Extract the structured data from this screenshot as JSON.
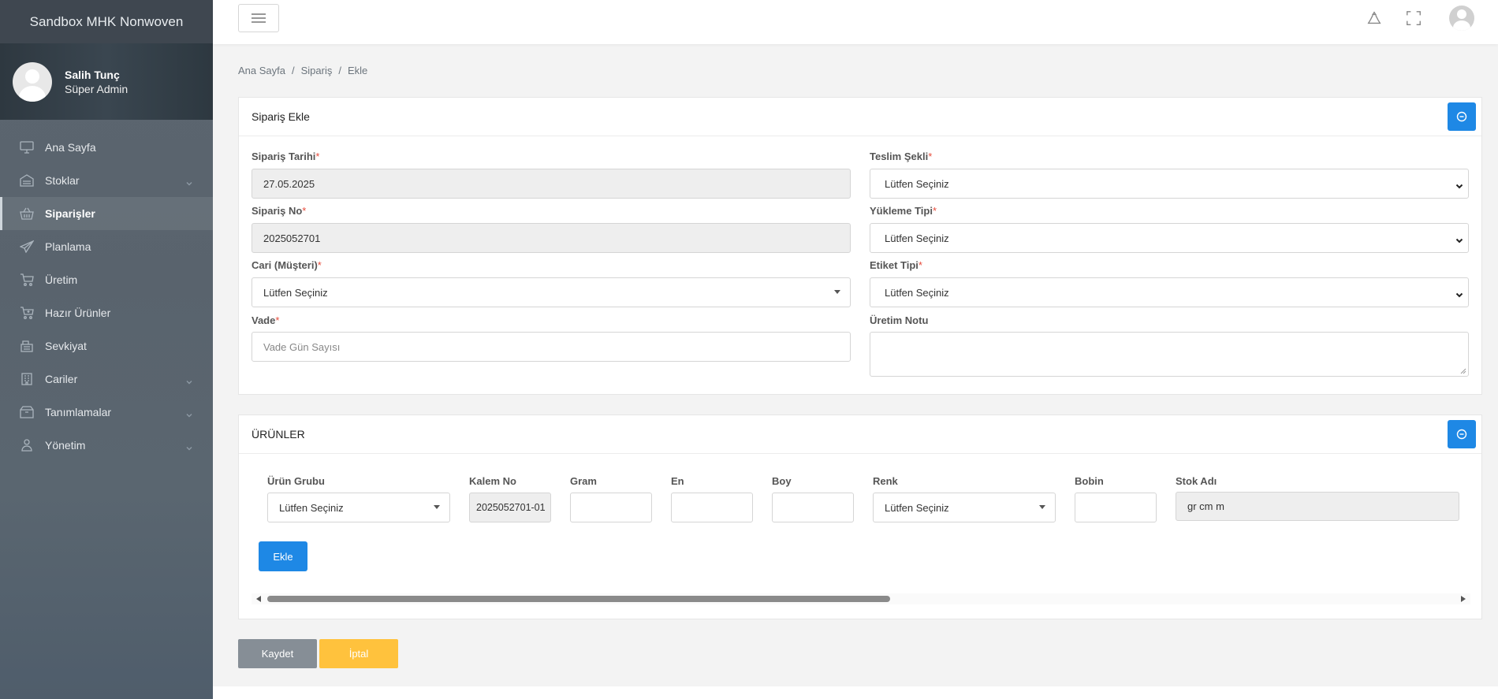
{
  "app": {
    "brand": "Sandbox MHK Nonwoven"
  },
  "user": {
    "name": "Salih Tunç",
    "role": "Süper Admin"
  },
  "sidebar": {
    "items": [
      {
        "label": "Ana Sayfa",
        "icon": "monitor-icon",
        "active": false,
        "expandable": false
      },
      {
        "label": "Stoklar",
        "icon": "warehouse-icon",
        "active": false,
        "expandable": true
      },
      {
        "label": "Siparişler",
        "icon": "basket-icon",
        "active": true,
        "expandable": false
      },
      {
        "label": "Planlama",
        "icon": "paper-plane-icon",
        "active": false,
        "expandable": false
      },
      {
        "label": "Üretim",
        "icon": "cart-icon",
        "active": false,
        "expandable": false
      },
      {
        "label": "Hazır Ürünler",
        "icon": "cart-plus-icon",
        "active": false,
        "expandable": false
      },
      {
        "label": "Sevkiyat",
        "icon": "cash-register-icon",
        "active": false,
        "expandable": false
      },
      {
        "label": "Cariler",
        "icon": "building-icon",
        "active": false,
        "expandable": true
      },
      {
        "label": "Tanımlamalar",
        "icon": "box-icon",
        "active": false,
        "expandable": true
      },
      {
        "label": "Yönetim",
        "icon": "users-icon",
        "active": false,
        "expandable": true
      }
    ]
  },
  "breadcrumb": [
    "Ana Sayfa",
    "Sipariş",
    "Ekle"
  ],
  "order_card": {
    "title": "Sipariş Ekle",
    "order_date": {
      "label": "Sipariş Tarihi",
      "value": "27.05.2025"
    },
    "order_no": {
      "label": "Sipariş No",
      "value": "2025052701"
    },
    "customer": {
      "label": "Cari (Müşteri)",
      "value": "Lütfen Seçiniz"
    },
    "due": {
      "label": "Vade",
      "placeholder": "Vade Gün Sayısı"
    },
    "delivery": {
      "label": "Teslim Şekli",
      "value": "Lütfen Seçiniz"
    },
    "loading": {
      "label": "Yükleme Tipi",
      "value": "Lütfen Seçiniz"
    },
    "label_type": {
      "label": "Etiket Tipi",
      "value": "Lütfen Seçiniz"
    },
    "production_note": {
      "label": "Üretim Notu",
      "value": ""
    },
    "required_mark": "*"
  },
  "products_card": {
    "title": "ÜRÜNLER",
    "columns": {
      "group": "Ürün Grubu",
      "item_no": "Kalem No",
      "gram": "Gram",
      "en": "En",
      "boy": "Boy",
      "color": "Renk",
      "bobin": "Bobin",
      "stock_name": "Stok Adı"
    },
    "row": {
      "group": "Lütfen Seçiniz",
      "item_no": "2025052701-01",
      "gram": "",
      "en": "",
      "boy": "",
      "color": "Lütfen Seçiniz",
      "bobin": "",
      "stock_name": "gr cm m"
    },
    "add_button": "Ekle"
  },
  "actions": {
    "save": "Kaydet",
    "cancel": "İptal"
  },
  "colors": {
    "primary": "#1e88e5",
    "save": "#868e96",
    "cancel": "#ffc23d",
    "required": "#e74c3c"
  }
}
